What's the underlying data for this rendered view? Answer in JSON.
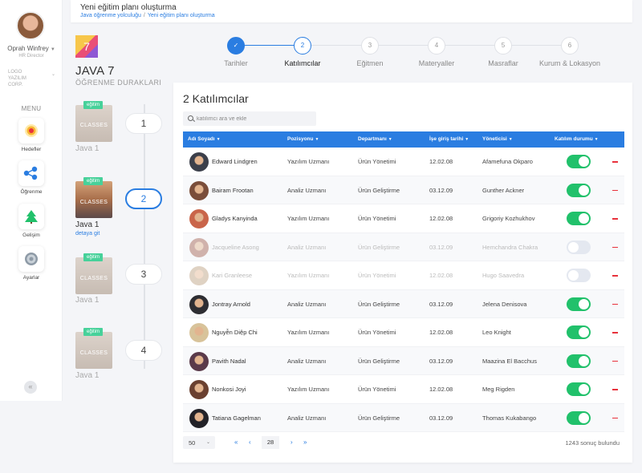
{
  "user": {
    "name": "Oprah Winfrey",
    "role": "HR Director",
    "company": "LOGO YAZILIM CORP."
  },
  "menu": {
    "title": "MENU",
    "items": [
      {
        "label": "Hedefler",
        "icon": "target-icon"
      },
      {
        "label": "Öğrenme",
        "icon": "learning-icon"
      },
      {
        "label": "Gelişim",
        "icon": "tree-icon"
      },
      {
        "label": "Ayarlar",
        "icon": "settings-icon"
      }
    ]
  },
  "header": {
    "title": "Yeni eğitim planı oluşturma",
    "breadcrumb": [
      "Java öğrenme yolculuğu",
      "Yeni eğitim planı oluşturma"
    ]
  },
  "course": {
    "logo_text": "7",
    "title": "JAVA 7",
    "subtitle": "ÖĞRENME DURAKLARI",
    "stops": [
      {
        "number": "1",
        "badge": "eğitim",
        "thumb_text": "CLASSES",
        "label": "Java 1"
      },
      {
        "number": "2",
        "badge": "eğitim",
        "thumb_text": "CLASSES",
        "label": "Java 1",
        "link": "detaya git"
      },
      {
        "number": "3",
        "badge": "eğitim",
        "thumb_text": "CLASSES",
        "label": "Java 1"
      },
      {
        "number": "4",
        "badge": "eğitim",
        "thumb_text": "CLASSES",
        "label": "Java 1"
      }
    ]
  },
  "stepper": {
    "steps": [
      {
        "number": "✓",
        "label": "Tarihler",
        "state": "done"
      },
      {
        "number": "2",
        "label": "Katılımcılar",
        "state": "current"
      },
      {
        "number": "3",
        "label": "Eğitmen",
        "state": "pending"
      },
      {
        "number": "4",
        "label": "Materyaller",
        "state": "pending"
      },
      {
        "number": "5",
        "label": "Masraflar",
        "state": "pending"
      },
      {
        "number": "6",
        "label": "Kurum & Lokasyon",
        "state": "pending"
      }
    ]
  },
  "participants": {
    "title": "2 Katılımcılar",
    "search_placeholder": "katılımcı ara ve ekle",
    "columns": [
      "Adı Soyadı",
      "Pozisyonu",
      "Departmanı",
      "İşe giriş tarihi",
      "Yöneticisi",
      "Katılım durumu"
    ],
    "rows": [
      {
        "name": "Edward Lindgren",
        "position": "Yazılım Uzmanı",
        "department": "Ürün Yönetimi",
        "start_date": "12.02.08",
        "manager": "Afamefuna Okparo",
        "active": true,
        "avatar_color": "#3b3f4a"
      },
      {
        "name": "Bairam Frootan",
        "position": "Analiz Uzmanı",
        "department": "Ürün Geliştirme",
        "start_date": "03.12.09",
        "manager": "Gunther Ackner",
        "active": true,
        "avatar_color": "#7a4d3a"
      },
      {
        "name": "Gladys Kanyinda",
        "position": "Yazılım Uzmanı",
        "department": "Ürün Yönetimi",
        "start_date": "12.02.08",
        "manager": "Grigoriy Kozhukhov",
        "active": true,
        "avatar_color": "#c9654a"
      },
      {
        "name": "Jacqueline Asong",
        "position": "Analiz Uzmanı",
        "department": "Ürün Geliştirme",
        "start_date": "03.12.09",
        "manager": "Hemchandra Chakra",
        "active": false,
        "avatar_color": "#a05a4a"
      },
      {
        "name": "Kari Granleese",
        "position": "Yazılım Uzmanı",
        "department": "Ürün Yönetimi",
        "start_date": "12.02.08",
        "manager": "Hugo Saavedra",
        "active": false,
        "avatar_color": "#b89a7a"
      },
      {
        "name": "Jontray Arnold",
        "position": "Analiz Uzmanı",
        "department": "Ürün Geliştirme",
        "start_date": "03.12.09",
        "manager": "Jelena Denisova",
        "active": true,
        "avatar_color": "#2e2e33"
      },
      {
        "name": "Nguyễn Diệp Chi",
        "position": "Yazılım Uzmanı",
        "department": "Ürün Yönetimi",
        "start_date": "12.02.08",
        "manager": "Leo Knight",
        "active": true,
        "avatar_color": "#d8c39a"
      },
      {
        "name": "Pavith Nadal",
        "position": "Analiz Uzmanı",
        "department": "Ürün Geliştirme",
        "start_date": "03.12.09",
        "manager": "Maazina El Bacchus",
        "active": true,
        "avatar_color": "#5a3a4a"
      },
      {
        "name": "Nonkosi Joyi",
        "position": "Yazılım Uzmanı",
        "department": "Ürün Yönetimi",
        "start_date": "12.02.08",
        "manager": "Meg Rigden",
        "active": true,
        "avatar_color": "#6a4030"
      },
      {
        "name": "Tatiana Gagelman",
        "position": "Analiz Uzmanı",
        "department": "Ürün Geliştirme",
        "start_date": "03.12.09",
        "manager": "Thomas Kukabango",
        "active": true,
        "avatar_color": "#222228"
      }
    ]
  },
  "pagination": {
    "page_size": "50",
    "current_page": "28",
    "results": "1243 sonuç bulundu",
    "first": "«",
    "prev": "‹",
    "next": "›",
    "last": "»"
  },
  "colors": {
    "accent": "#2a7de1",
    "success": "#21c16b",
    "danger": "#e8323c",
    "badge": "#47d19a"
  }
}
